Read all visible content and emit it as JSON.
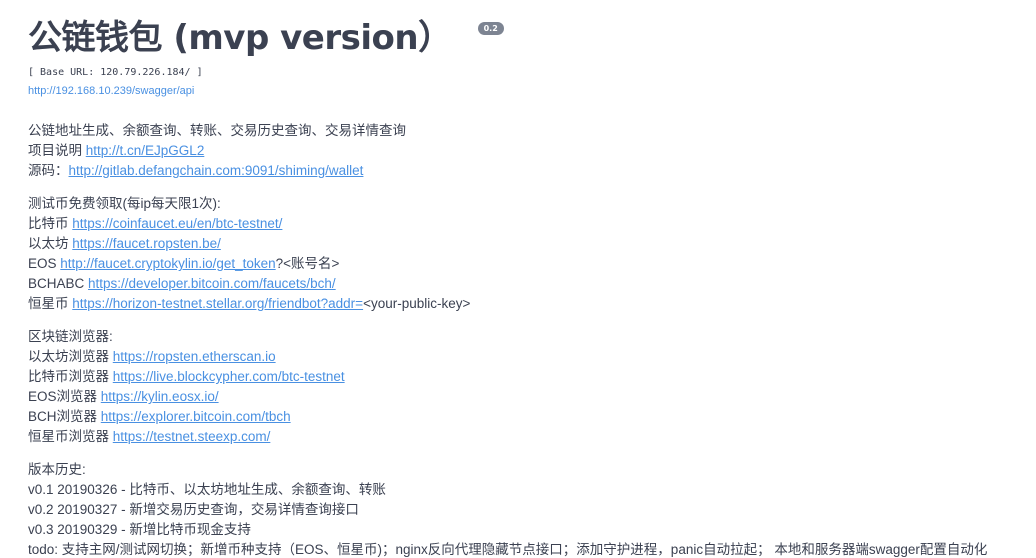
{
  "header": {
    "title": "公链钱包 (mvp version）",
    "version_badge": "0.2",
    "base_url": "[ Base URL: 120.79.226.184/ ]",
    "spec_url": "http://192.168.10.239/swagger/api"
  },
  "intro": {
    "features": "公链地址生成、余额查询、转账、交易历史查询、交易详情查询",
    "project_label": "项目说明",
    "project_link": "http://t.cn/EJpGGL2",
    "source_label": "源码：",
    "source_link": "http://gitlab.defangchain.com:9091/shiming/wallet"
  },
  "faucets": {
    "heading": "测试币免费领取(每ip每天限1次):",
    "items": [
      {
        "label": "比特币",
        "link": "https://coinfaucet.eu/en/btc-testnet/",
        "suffix": ""
      },
      {
        "label": "以太坊",
        "link": "https://faucet.ropsten.be/",
        "suffix": ""
      },
      {
        "label": "EOS",
        "link": "http://faucet.cryptokylin.io/get_token",
        "suffix": "?<账号名>"
      },
      {
        "label": "BCHABC",
        "link": "https://developer.bitcoin.com/faucets/bch/",
        "suffix": ""
      },
      {
        "label": "恒星币",
        "link": "https://horizon-testnet.stellar.org/friendbot?addr=",
        "suffix": "<your-public-key>"
      }
    ]
  },
  "explorers": {
    "heading": "区块链浏览器:",
    "items": [
      {
        "label": "以太坊浏览器",
        "link": "https://ropsten.etherscan.io"
      },
      {
        "label": "比特币浏览器",
        "link": "https://live.blockcypher.com/btc-testnet"
      },
      {
        "label": "EOS浏览器",
        "link": "https://kylin.eosx.io/"
      },
      {
        "label": "BCH浏览器",
        "link": "https://explorer.bitcoin.com/tbch"
      },
      {
        "label": "恒星币浏览器",
        "link": "https://testnet.steexp.com/"
      }
    ]
  },
  "history": {
    "heading": "版本历史:",
    "items": [
      "v0.1 20190326 - 比特币、以太坊地址生成、余额查询、转账",
      "v0.2 20190327 - 新增交易历史查询，交易详情查询接口",
      "v0.3 20190329 - 新增比特币现金支持"
    ],
    "todo": "todo: 支持主网/测试网切换；新增币种支持（EOS、恒星币)；nginx反向代理隐藏节点接口；添加守护进程，panic自动拉起； 本地和服务器端swagger配置自动化"
  }
}
